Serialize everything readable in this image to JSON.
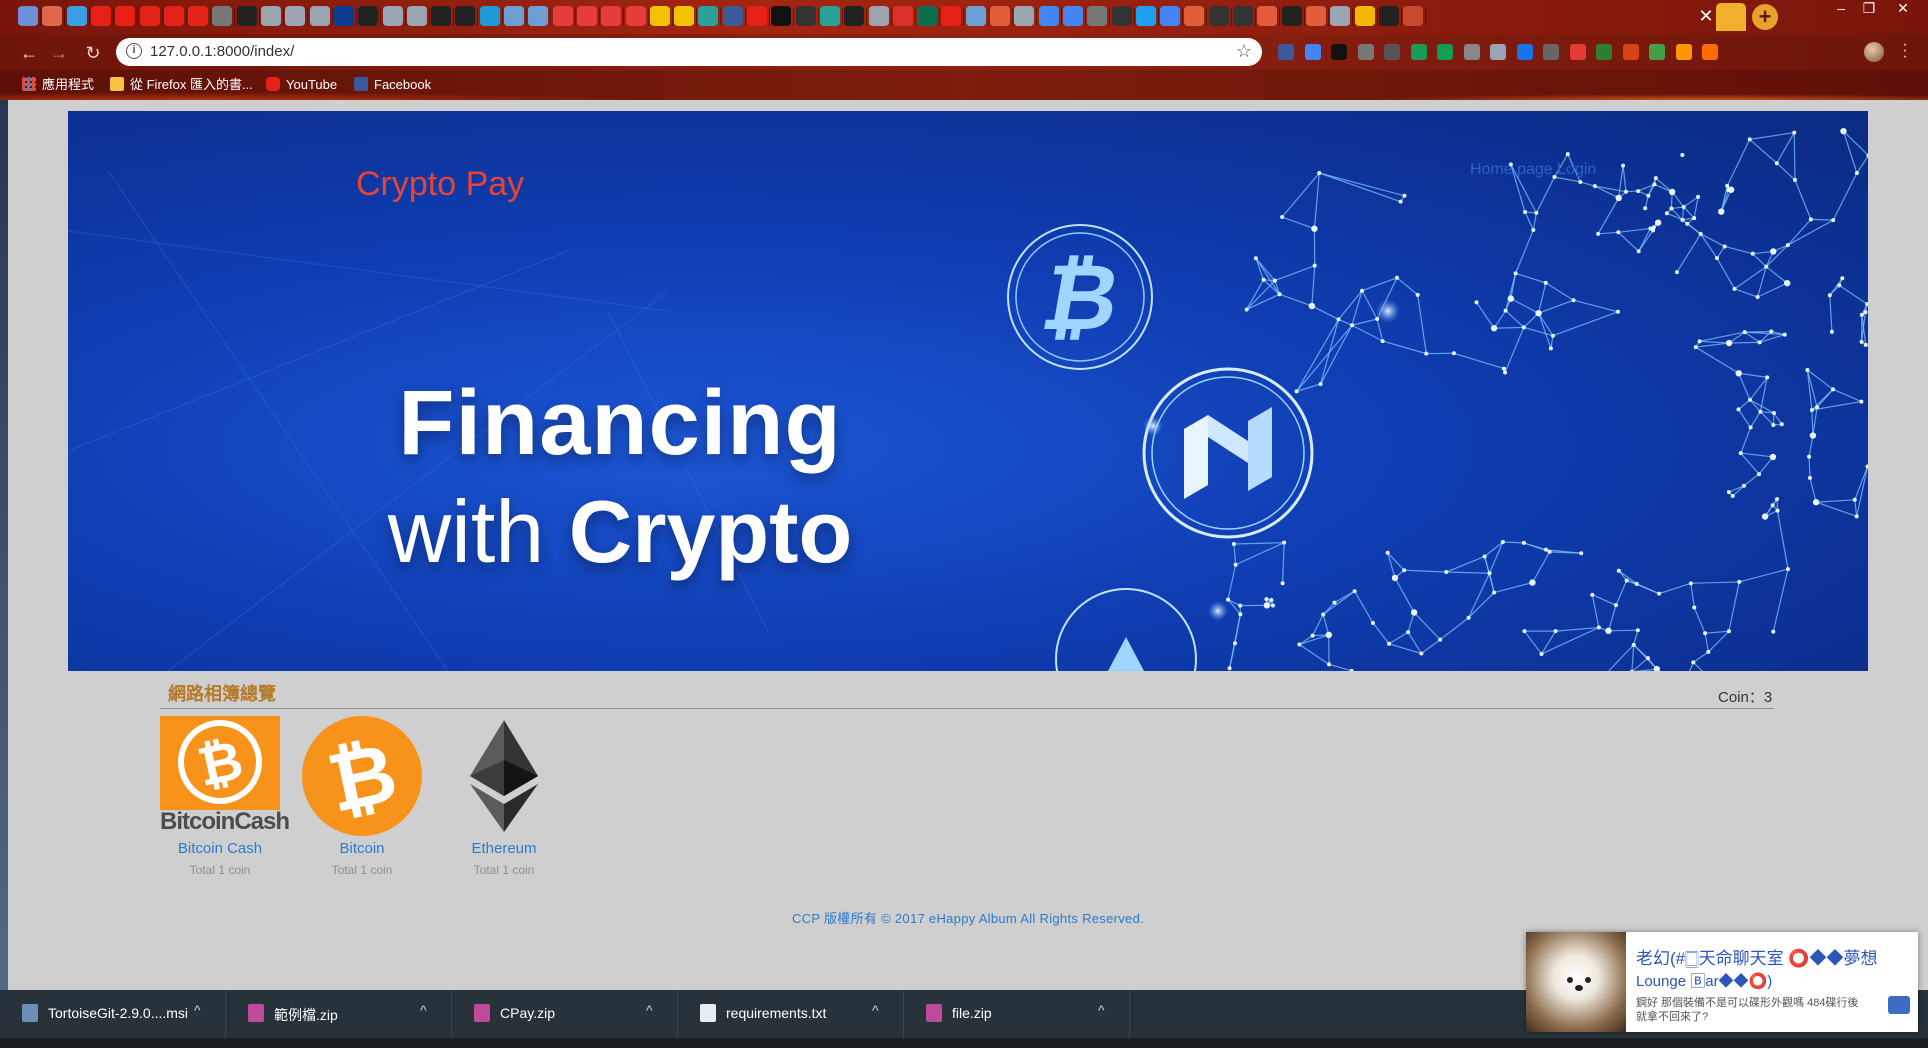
{
  "browser": {
    "url": "127.0.0.1:8000/index/",
    "tab_icon_colors": [
      "#6c8fd8",
      "#e0664a",
      "#3aa0e6",
      "#e62117",
      "#e62117",
      "#e62117",
      "#e62117",
      "#e62117",
      "#777",
      "#222",
      "#9aa5b1",
      "#9aa5b1",
      "#9aa5b1",
      "#0a3d91",
      "#222",
      "#9aa5b1",
      "#9aa5b1",
      "#222",
      "#222",
      "#1a9ad6",
      "#6f9fd2",
      "#6f9fd2",
      "#e63c3c",
      "#e63c3c",
      "#e63c3c",
      "#e63c3c",
      "#f2c200",
      "#f2c200",
      "#2aa198",
      "#3b5998",
      "#e62117",
      "#111",
      "#333",
      "#2aa198",
      "#222",
      "#9aa5b1",
      "#d8302c",
      "#0b6e4f",
      "#e62117",
      "#6f9fd2",
      "#e25d3a",
      "#9aa5b1",
      "#4285f4",
      "#4285f4",
      "#777",
      "#333",
      "#1da1f2",
      "#4285f4",
      "#e25d3a",
      "#333",
      "#333",
      "#e25d3a",
      "#222",
      "#e25d3a",
      "#9aa5b1",
      "#f2b705",
      "#222",
      "#c64a2b"
    ],
    "extension_colors": [
      "#3b5998",
      "#4285f4",
      "#111",
      "#777",
      "#555",
      "#1a9a56",
      "#0f9d58",
      "#888",
      "#9aa5b1",
      "#1a73e8",
      "#666",
      "#e53935",
      "#2e7d32",
      "#d84315",
      "#43a047",
      "#ff9800",
      "#ff6d00"
    ],
    "window_controls": [
      "–",
      "❐",
      "✕"
    ]
  },
  "bookmarks": [
    {
      "label": "應用程式",
      "icon": "apps-grid-icon",
      "color": "#e04c3a"
    },
    {
      "label": "從 Firefox 匯入的書...",
      "icon": "folder-icon",
      "color": "#f6c343"
    },
    {
      "label": "YouTube",
      "icon": "youtube-icon",
      "color": "#e62117"
    },
    {
      "label": "Facebook",
      "icon": "facebook-icon",
      "color": "#3b5998"
    }
  ],
  "site": {
    "brand": "Crypto Pay",
    "nav": {
      "home": "Home page",
      "login": "Login"
    },
    "hero_line1": "Financing",
    "hero_line2_a": "with",
    "hero_line2_b": "Crypto",
    "section_title": "網路相簿總覽",
    "coin_count": "Coin：3",
    "coins": [
      {
        "name": "Bitcoin Cash",
        "total": "Total 1 coin",
        "logo_text": "BitcoinCash"
      },
      {
        "name": "Bitcoin",
        "total": "Total 1 coin"
      },
      {
        "name": "Ethereum",
        "total": "Total 1 coin"
      }
    ],
    "footer": "CCP  版權所有 © 2017 eHappy Album All Rights Reserved.",
    "colors": {
      "brand": "#e74533",
      "banner_blue": "#0f3cb0",
      "link_blue": "#2c7bd0",
      "section_title": "#b57a2a",
      "bitcoin_orange": "#f7931a"
    }
  },
  "downloads": [
    {
      "name": "TortoiseGit-2.9.0....msi",
      "icon": "msi-file-icon",
      "color": "#6d8fb5"
    },
    {
      "name": "範例檔.zip",
      "icon": "zip-file-icon",
      "color": "#c04a9a"
    },
    {
      "name": "CPay.zip",
      "icon": "zip-file-icon",
      "color": "#c04a9a"
    },
    {
      "name": "requirements.txt",
      "icon": "text-file-icon",
      "color": "#e8edf2"
    },
    {
      "name": "file.zip",
      "icon": "zip-file-icon",
      "color": "#c04a9a"
    }
  ],
  "notification": {
    "title": "老幻(#🀆天命聊天室 ⭕◆◆夢想",
    "subtitle": "Lounge 🄱ar◆◆⭕)",
    "message": "鋼好 那個裝備不是可以碟形外觀嗎 484碟行後就拿不回來了?"
  }
}
